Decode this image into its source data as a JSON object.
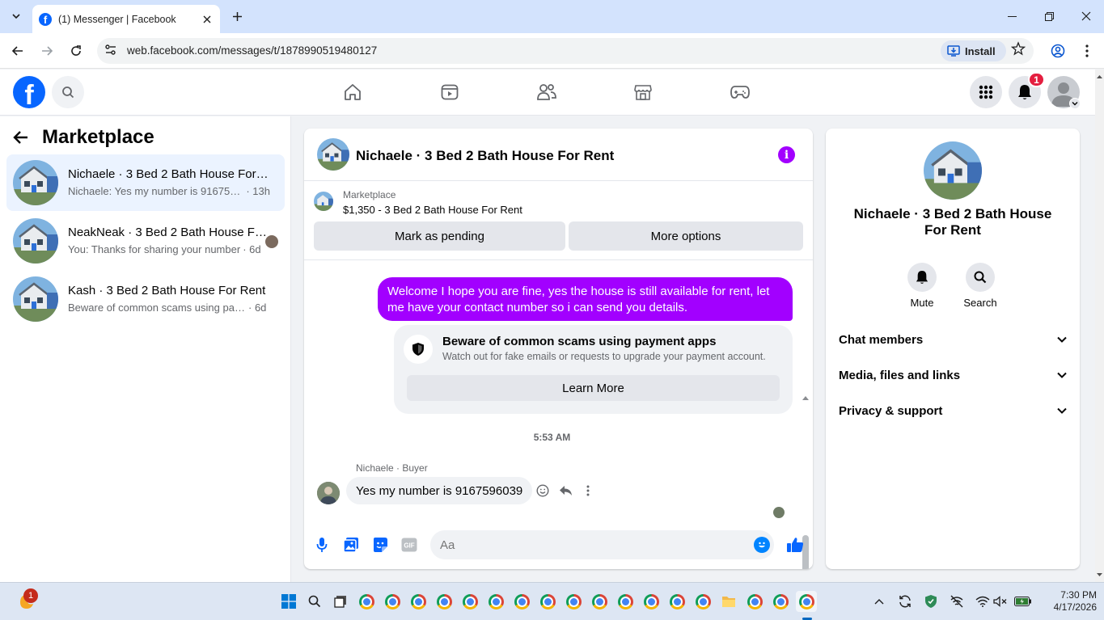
{
  "browser": {
    "tab_title": "(1) Messenger | Facebook",
    "url": "web.facebook.com/messages/t/1878990519480127",
    "install_label": "Install"
  },
  "header": {
    "notification_count": "1"
  },
  "sidebar": {
    "title": "Marketplace",
    "conversations": [
      {
        "name": "Nichaele · 3 Bed 2 Bath House For Rent",
        "preview": "Nichaele: Yes my number is 9167596039",
        "time": "· 13h"
      },
      {
        "name": "NeakNeak · 3 Bed 2 Bath House For Rent",
        "preview": "You: Thanks for sharing your number",
        "time": "· 6d"
      },
      {
        "name": "Kash · 3 Bed 2 Bath House For Rent",
        "preview": "Beware of common scams using payment apps",
        "time": "· 6d"
      }
    ]
  },
  "chat": {
    "title": "Nichaele · 3 Bed 2 Bath House For Rent",
    "listing_label": "Marketplace",
    "listing_title": "$1,350 - 3 Bed 2 Bath House For Rent",
    "mark_pending_label": "Mark as pending",
    "more_options_label": "More options",
    "outgoing_message": "Welcome I hope you are fine, yes the house is still available for rent, let me have your contact number so i can send you  details.",
    "scam_title": "Beware of common scams using payment apps",
    "scam_description": "Watch out for fake emails or requests to upgrade your payment account.",
    "learn_more_label": "Learn More",
    "timestamp": "5:53 AM",
    "sender_label": "Nichaele · Buyer",
    "incoming_message": "Yes my number is 9167596039",
    "composer_placeholder": "Aa",
    "accent_color": "#a200ff"
  },
  "info_panel": {
    "name": "Nichaele · 3 Bed 2 Bath House For Rent",
    "mute_label": "Mute",
    "search_label": "Search",
    "rows": [
      "Chat members",
      "Media, files and links",
      "Privacy & support"
    ]
  },
  "taskbar": {
    "weather_badge": "1",
    "time": "7:30 PM",
    "date": "4/17/2026"
  }
}
